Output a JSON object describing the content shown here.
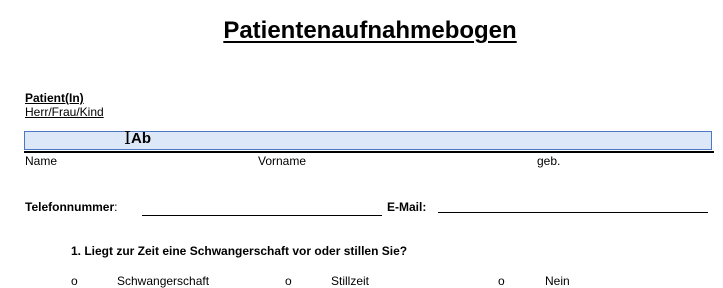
{
  "form": {
    "title": "Patientenaufnahmebogen",
    "section_label": "Patient(In)",
    "section_sublabel": "Herr/Frau/Kind",
    "name_field": {
      "value": "Ab",
      "caret": "text-cursor-icon"
    },
    "name_sublabels": {
      "name": "Name",
      "vorname": "Vorname",
      "geb": "geb."
    },
    "telefon_label": "Telefonnummer",
    "telefon_colon": ":",
    "email_label": "E-Mail:",
    "question_1": "1. Liegt zur Zeit eine Schwangerschaft vor oder stillen Sie?",
    "options": [
      {
        "bullet": "o",
        "label": "Schwangerschaft"
      },
      {
        "bullet": "o",
        "label": "Stillzeit"
      },
      {
        "bullet": "o",
        "label": "Nein"
      }
    ]
  },
  "colors": {
    "field_fill": "#dce8f8",
    "field_border": "#4a78c2"
  }
}
